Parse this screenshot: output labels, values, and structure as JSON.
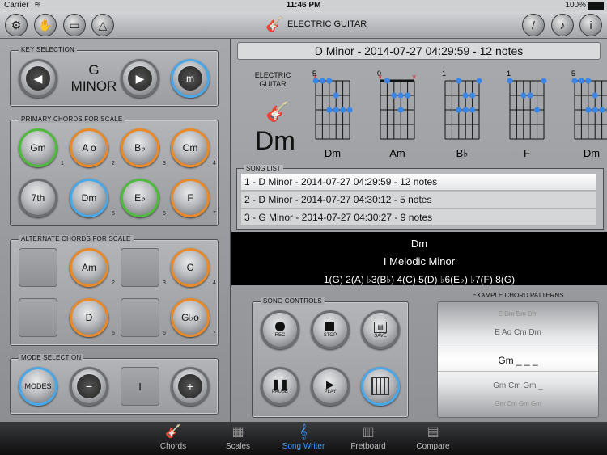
{
  "status_bar": {
    "carrier": "Carrier",
    "time": "11:46 PM",
    "battery": "100%"
  },
  "toolbar": {
    "title": "ELECTRIC GUITAR",
    "left_buttons": [
      "gear-icon",
      "hand-icon",
      "guitar-case-icon",
      "metronome-icon"
    ],
    "right_buttons": [
      "tuning-fork-icon",
      "music-note-icon",
      "info-icon"
    ]
  },
  "key_selection": {
    "label": "KEY SELECTION",
    "key": "G",
    "scale": "MINOR",
    "mode_toggle": "m"
  },
  "primary_chords": {
    "label": "PRIMARY CHORDS FOR SCALE",
    "chords": [
      {
        "name": "Gm",
        "color": "green",
        "degree": "1"
      },
      {
        "name": "A o",
        "color": "orange",
        "degree": "2"
      },
      {
        "name": "B♭",
        "color": "orange",
        "degree": "3"
      },
      {
        "name": "Cm",
        "color": "orange",
        "degree": "4"
      },
      {
        "name": "7th",
        "color": "gray",
        "degree": ""
      },
      {
        "name": "Dm",
        "color": "blue",
        "degree": "5"
      },
      {
        "name": "E♭",
        "color": "green",
        "degree": "6"
      },
      {
        "name": "F",
        "color": "orange",
        "degree": "7"
      }
    ]
  },
  "alternate_chords": {
    "label": "ALTERNATE CHORDS FOR SCALE",
    "chords": [
      {
        "name": "",
        "degree": ""
      },
      {
        "name": "Am",
        "degree": "2"
      },
      {
        "name": "",
        "degree": "3"
      },
      {
        "name": "C",
        "degree": "4"
      },
      {
        "name": "",
        "degree": ""
      },
      {
        "name": "D",
        "degree": "5"
      },
      {
        "name": "",
        "degree": "6"
      },
      {
        "name": "G♭o",
        "degree": "7"
      }
    ]
  },
  "mode_selection": {
    "label": "MODE SELECTION",
    "modes_label": "MODES",
    "minus": "−",
    "value": "I",
    "plus": "+"
  },
  "scale_header": "D Minor - 2014-07-27 04:29:59  - 12 notes",
  "instrument": {
    "line1": "ELECTRIC",
    "line2": "GUITAR",
    "current_chord": "Dm"
  },
  "diagrams": [
    {
      "name": "Dm",
      "fret": "5"
    },
    {
      "name": "Am",
      "fret": "0"
    },
    {
      "name": "B♭",
      "fret": "1"
    },
    {
      "name": "F",
      "fret": "1"
    },
    {
      "name": "Dm",
      "fret": "5"
    }
  ],
  "song_list": {
    "label": "SONG LIST",
    "items": [
      "1 - D Minor - 2014-07-27 04:29:59  - 12 notes",
      "2 - D Minor - 2014-07-27 04:30:12  - 5 notes",
      "3 - G Minor - 2014-07-27 04:30:27  - 9 notes"
    ]
  },
  "scale_info": {
    "chord": "Dm",
    "mode": "I Melodic Minor",
    "degrees": "1(G)  2(A)  ♭3(B♭)  4(C)  5(D)  ♭6(E♭)  ♭7(F)  8(G)"
  },
  "song_controls": {
    "label": "SONG CONTROLS",
    "buttons": [
      "REC",
      "STOP",
      "SAVE",
      "PAUSE",
      "PLAY",
      ""
    ]
  },
  "patterns": {
    "label": "EXAMPLE CHORD PATTERNS",
    "items": [
      "E  Dm  Em  Dm",
      "E  Ao  Cm  Dm",
      "Gm  _  _  _",
      "Gm  Cm  Gm  _",
      "Gm  Cm  Gm  Gm"
    ]
  },
  "tabs": [
    {
      "label": "Chords",
      "icon": "guitar-icon",
      "active": false
    },
    {
      "label": "Scales",
      "icon": "scales-icon",
      "active": false
    },
    {
      "label": "Song Writer",
      "icon": "treble-clef-icon",
      "active": true
    },
    {
      "label": "Fretboard",
      "icon": "fretboard-icon",
      "active": false
    },
    {
      "label": "Compare",
      "icon": "compare-icon",
      "active": false
    }
  ]
}
